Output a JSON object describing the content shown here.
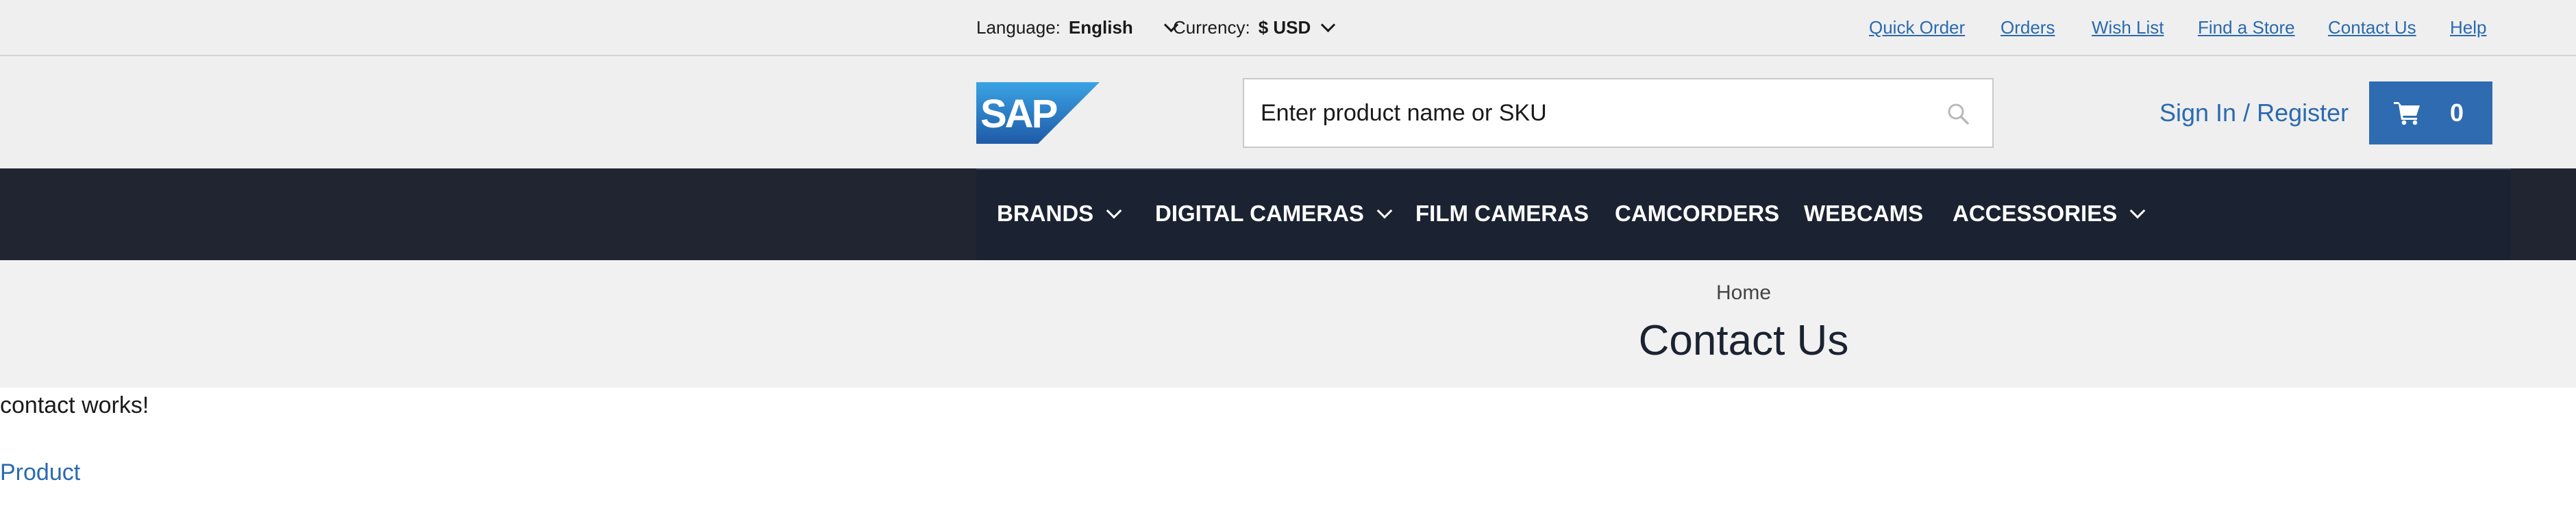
{
  "topbar": {
    "language": {
      "label": "Language:",
      "value": "English"
    },
    "currency": {
      "label": "Currency:",
      "value": "$ USD"
    },
    "links": [
      "Quick Order",
      "Orders",
      "Wish List",
      "Find a Store",
      "Contact Us",
      "Help"
    ]
  },
  "header": {
    "logo_text": "SAP",
    "search": {
      "placeholder": "Enter product name or SKU",
      "value": ""
    },
    "signin_label": "Sign In / Register",
    "cart_count": "0"
  },
  "nav": {
    "items": [
      {
        "label": "BRANDS",
        "has_dropdown": true
      },
      {
        "label": "DIGITAL CAMERAS",
        "has_dropdown": true
      },
      {
        "label": "FILM CAMERAS",
        "has_dropdown": false
      },
      {
        "label": "CAMCORDERS",
        "has_dropdown": false
      },
      {
        "label": "WEBCAMS",
        "has_dropdown": false
      },
      {
        "label": "ACCESSORIES",
        "has_dropdown": true
      }
    ]
  },
  "breadcrumb": {
    "home": "Home"
  },
  "page": {
    "title": "Contact Us",
    "body_text": "contact works!",
    "product_link": "Product"
  },
  "colors": {
    "link": "#2a6ab0",
    "nav_bg": "#1b2332",
    "cart_bg": "#2f6bb1",
    "topbar_bg": "#efefef"
  },
  "icons": [
    "chevron-down-icon",
    "search-icon",
    "cart-icon",
    "sap-logo"
  ]
}
